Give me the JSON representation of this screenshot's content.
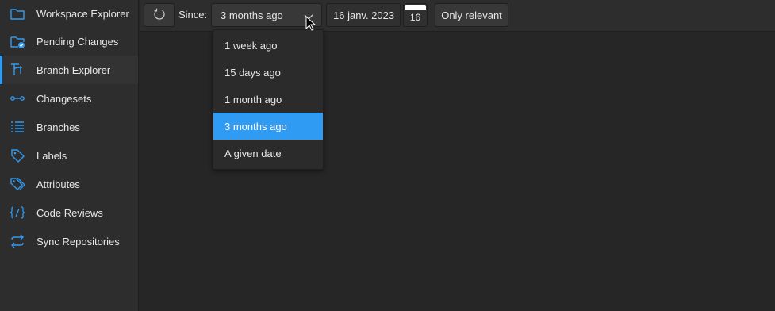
{
  "colors": {
    "accent": "#2f9bf2",
    "background": "#262626",
    "sidebar": "#2d2d2d"
  },
  "sidebar": {
    "items": [
      {
        "label": "Workspace Explorer",
        "icon": "folder-icon"
      },
      {
        "label": "Pending Changes",
        "icon": "folder-check-icon"
      },
      {
        "label": "Branch Explorer",
        "icon": "branch-explorer-icon",
        "active": true
      },
      {
        "label": "Changesets",
        "icon": "changesets-icon"
      },
      {
        "label": "Branches",
        "icon": "list-icon"
      },
      {
        "label": "Labels",
        "icon": "tag-icon"
      },
      {
        "label": "Attributes",
        "icon": "tags-icon"
      },
      {
        "label": "Code Reviews",
        "icon": "code-review-icon"
      },
      {
        "label": "Sync Repositories",
        "icon": "sync-icon"
      }
    ]
  },
  "toolbar": {
    "refresh_icon": "refresh-icon",
    "since_label": "Since:",
    "since_value": "3 months ago",
    "date_value": "16 janv. 2023",
    "calendar_day": "16",
    "only_relevant_label": "Only relevant"
  },
  "since_dropdown": {
    "options": [
      "1 week ago",
      "15 days ago",
      "1 month ago",
      "3 months ago",
      "A given date"
    ],
    "selected_index": 3
  }
}
